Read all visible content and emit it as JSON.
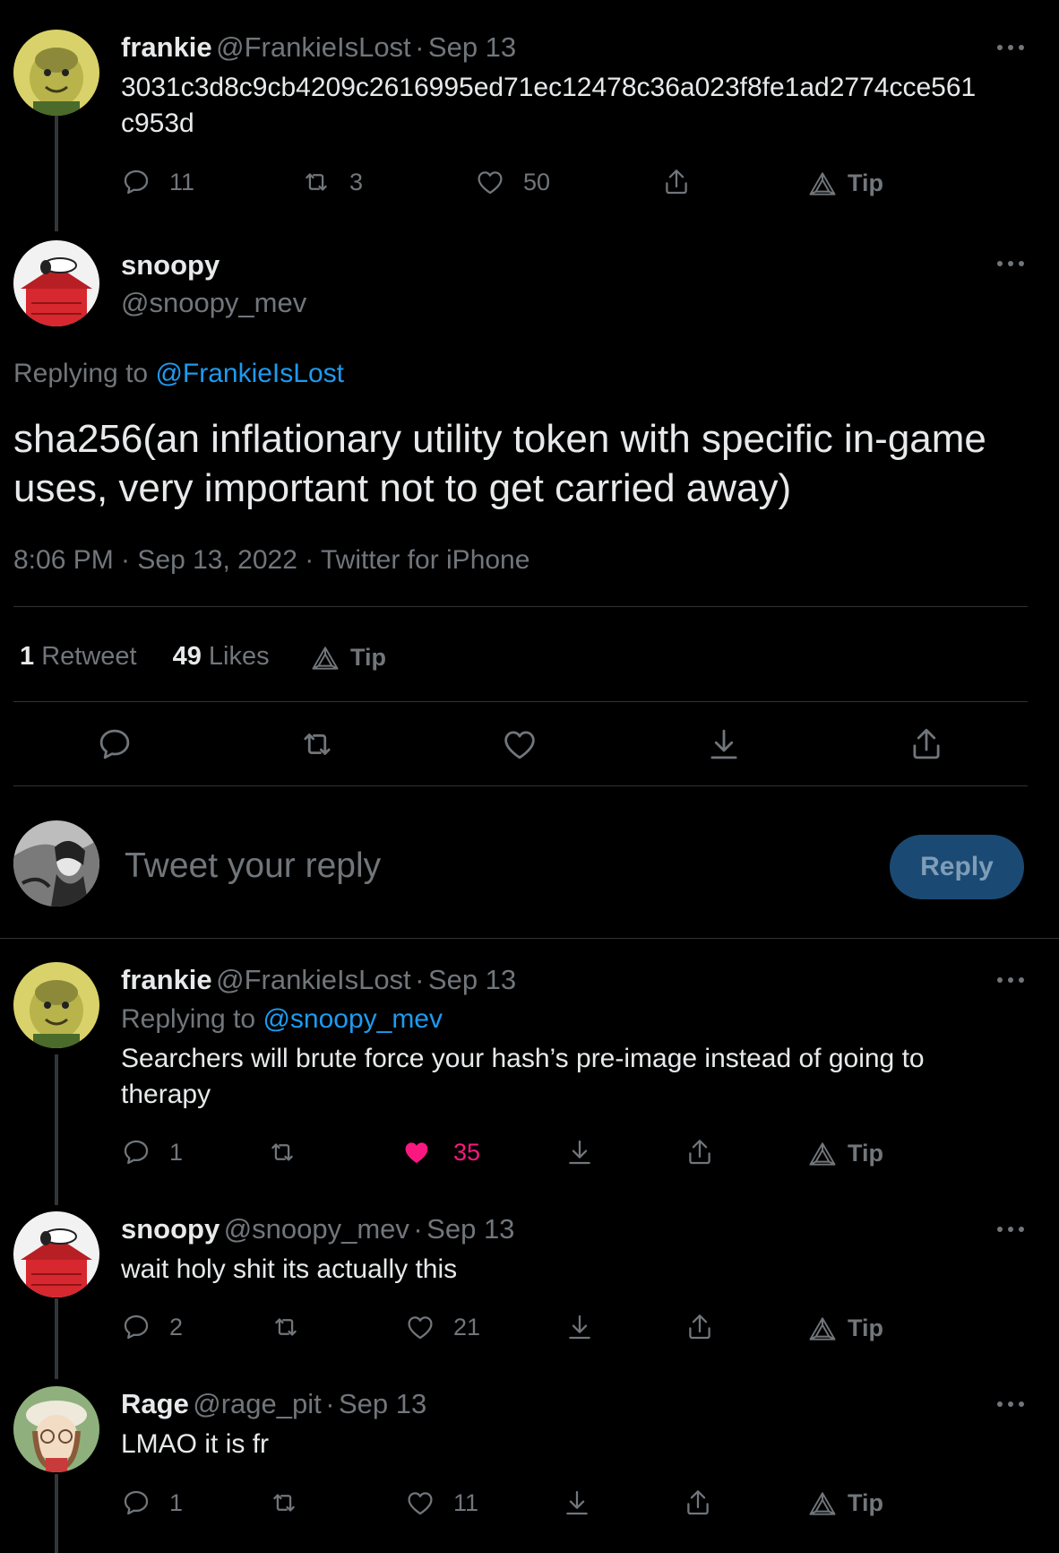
{
  "tweet1": {
    "name": "frankie",
    "handle": "@FrankieIsLost",
    "sep": "·",
    "date": "Sep 13",
    "text_line1": "3031c3d8c9cb4209c2616995ed71ec12478c36a023f8fe1ad2774cce561",
    "text_line2": "c953d",
    "replies": "11",
    "retweets": "3",
    "likes": "50",
    "tip": "Tip"
  },
  "main": {
    "name": "snoopy",
    "handle": "@snoopy_mev",
    "replying_prefix": "Replying to",
    "replying_to": "@FrankieIsLost",
    "text_line1": "sha256(an inflationary utility token with specific in-game",
    "text_line2": "uses, very important not to get carried away)",
    "meta": "8:06 PM · Sep 13, 2022 · Twitter for iPhone",
    "retweet_count": "1",
    "retweet_label": "Retweet",
    "like_count": "49",
    "like_label": "Likes",
    "tip": "Tip"
  },
  "composer": {
    "placeholder": "Tweet your reply",
    "reply_button": "Reply"
  },
  "reply1": {
    "name": "frankie",
    "handle": "@FrankieIsLost",
    "sep": "·",
    "date": "Sep 13",
    "replying_prefix": "Replying to",
    "replying_to": "@snoopy_mev",
    "text_line1": "Searchers will brute force your hash’s pre-image instead of going to",
    "text_line2": "therapy",
    "replies": "1",
    "likes": "35",
    "liked_color": "#f91880",
    "tip": "Tip"
  },
  "reply2": {
    "name": "snoopy",
    "handle": "@snoopy_mev",
    "sep": "·",
    "date": "Sep 13",
    "text": "wait holy shit its actually this",
    "replies": "2",
    "likes": "21",
    "tip": "Tip"
  },
  "reply3": {
    "name": "Rage",
    "handle": "@rage_pit",
    "sep": "·",
    "date": "Sep 13",
    "text": "LMAO it is fr",
    "replies": "1",
    "likes": "11",
    "tip": "Tip"
  },
  "colors": {
    "background": "#000000",
    "link": "#1d9bf0",
    "muted": "#71767b",
    "reply_button_bg": "#1a4a73",
    "like_active": "#f91880"
  },
  "icons": {
    "reply": "reply-icon",
    "retweet": "retweet-icon",
    "like": "heart-icon",
    "bookmark": "download-icon",
    "share": "share-icon",
    "tip": "tip-triangle-icon",
    "more": "more-dots-icon"
  }
}
